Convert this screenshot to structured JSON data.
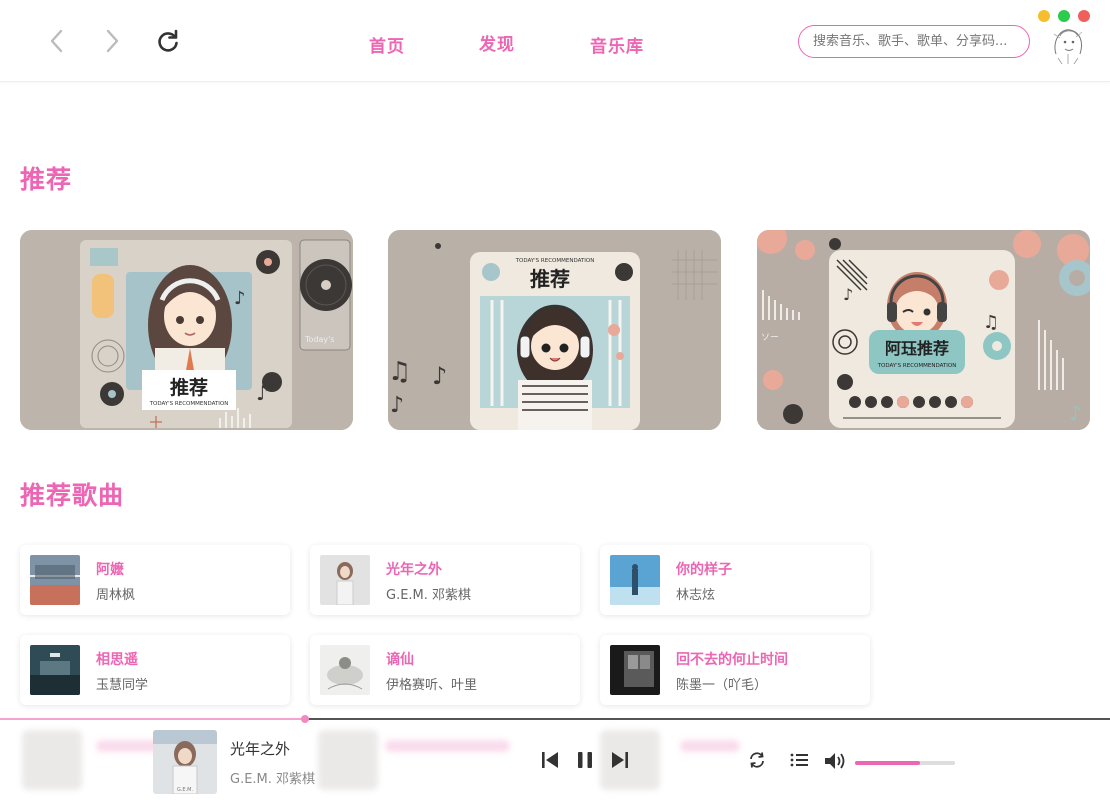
{
  "nav": {
    "back_icon": "chevron-left-icon",
    "forward_icon": "chevron-right-icon",
    "reload_icon": "reload-icon",
    "tabs": [
      {
        "label": "首页"
      },
      {
        "label": "发现"
      },
      {
        "label": "音乐库"
      }
    ],
    "search_placeholder": "搜索音乐、歌手、歌单、分享码..."
  },
  "colors": {
    "accent": "#ec66b4",
    "traffic_yellow": "#f6be2c",
    "traffic_green": "#2ccb4c",
    "traffic_red": "#f0605a"
  },
  "recommend": {
    "title": "推荐",
    "banners": [
      {
        "caption_main": "推荐",
        "caption_sub": "TODAY'S RECOMMENDATION",
        "side_text": "Today's"
      },
      {
        "caption_main": "推荐",
        "caption_sub": "TODAY'S RECOMMENDATION"
      },
      {
        "caption_main": "阿珏推荐",
        "caption_sub": "TODAY'S RECOMMENDATION",
        "side_text": "ソー"
      }
    ]
  },
  "songs": {
    "title": "推荐歌曲",
    "items": [
      {
        "title": "阿嬷",
        "artist": "周林枫"
      },
      {
        "title": "光年之外",
        "artist": "G.E.M. 邓紫棋"
      },
      {
        "title": "你的样子",
        "artist": "林志炫"
      },
      {
        "title": "相思遥",
        "artist": "玉慧同学"
      },
      {
        "title": "谪仙",
        "artist": "伊格赛听、叶里"
      },
      {
        "title": "回不去的何止时间",
        "artist": "陈墨一（吖毛）"
      }
    ]
  },
  "player": {
    "title": "光年之外",
    "artist": "G.E.M. 邓紫棋",
    "progress": 0.275,
    "volume": 0.65,
    "icons": [
      "skip-previous-icon",
      "pause-icon",
      "skip-next-icon",
      "repeat-icon",
      "playlist-icon",
      "volume-icon"
    ]
  }
}
